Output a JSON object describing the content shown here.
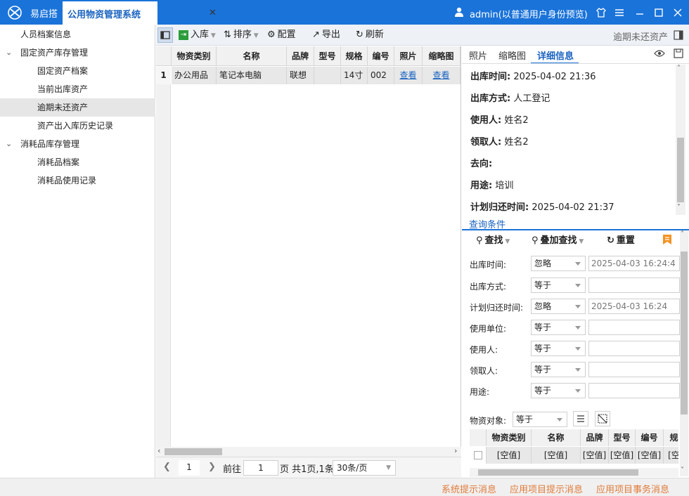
{
  "titlebar": {
    "app_name": "易启搭",
    "active_tab": "公用物资管理系统",
    "close_glyph": "✕",
    "user": "admin(以普通用户身份预览)",
    "icons": [
      "tshirt-icon",
      "menu-icon",
      "minimize-icon",
      "maximize-icon",
      "close-icon"
    ]
  },
  "sidebar": {
    "items": [
      {
        "label": "人员档案信息",
        "level": 0
      },
      {
        "label": "固定资产库存管理",
        "level": 0,
        "expanded": true
      },
      {
        "label": "固定资产档案",
        "level": 1
      },
      {
        "label": "当前出库资产",
        "level": 1
      },
      {
        "label": "逾期未还资产",
        "level": 1,
        "selected": true
      },
      {
        "label": "资产出入库历史记录",
        "level": 1
      },
      {
        "label": "消耗品库存管理",
        "level": 0,
        "expanded": true
      },
      {
        "label": "消耗品档案",
        "level": 1
      },
      {
        "label": "消耗品使用记录",
        "level": 1
      }
    ]
  },
  "toolbar": {
    "inbound": "入库",
    "sort": "排序",
    "config": "配置",
    "export": "导出",
    "refresh": "刷新",
    "current_view": "逾期未还资产"
  },
  "grid": {
    "headers": [
      "物资类别",
      "名称",
      "品牌",
      "型号",
      "规格",
      "编号",
      "照片",
      "缩略图"
    ],
    "rows": [
      {
        "num": "1",
        "cells": [
          "办公用品",
          "笔记本电脑",
          "联想",
          "",
          "14寸",
          "002",
          "查看",
          "查看"
        ]
      }
    ]
  },
  "pager": {
    "page_input": "1",
    "goto_label": "前往",
    "goto_value": "1",
    "summary": "页 共1页,1条",
    "page_size": "30条/页"
  },
  "detail_panel": {
    "tabs": [
      "照片",
      "缩略图",
      "详细信息"
    ],
    "active_tab": "详细信息",
    "fields": [
      {
        "label": "出库时间:",
        "value": "2025-04-02 21:36"
      },
      {
        "label": "出库方式:",
        "value": "人工登记"
      },
      {
        "label": "使用人:",
        "value": "姓名2"
      },
      {
        "label": "领取人:",
        "value": "姓名2"
      },
      {
        "label": "去向:",
        "value": ""
      },
      {
        "label": "用途:",
        "value": "培训"
      },
      {
        "label": "计划归还时间:",
        "value": "2025-04-02 21:37"
      }
    ]
  },
  "query": {
    "tab": "查询条件",
    "search": "查找",
    "add_search": "叠加查找",
    "reset": "重置",
    "conditions": [
      {
        "label": "出库时间:",
        "op": "忽略",
        "value": "2025-04-03 16:24:4"
      },
      {
        "label": "出库方式:",
        "op": "等于",
        "value": ""
      },
      {
        "label": "计划归还时间:",
        "op": "忽略",
        "value": "2025-04-03 16:24"
      },
      {
        "label": "使用单位:",
        "op": "等于",
        "value": ""
      },
      {
        "label": "使用人:",
        "op": "等于",
        "value": ""
      },
      {
        "label": "领取人:",
        "op": "等于",
        "value": ""
      },
      {
        "label": "用途:",
        "op": "等于",
        "value": ""
      }
    ],
    "object_label": "物资对象:",
    "object_op": "等于",
    "sub_headers": [
      "物资类别",
      "名称",
      "品牌",
      "型号",
      "编号",
      "规"
    ],
    "sub_row": [
      "[空值]",
      "[空值]",
      "[空值]",
      "[空值]",
      "[空值]",
      "[空"
    ]
  },
  "statusbar": {
    "items": [
      "系统提示消息",
      "应用项目提示消息",
      "应用项目事务消息"
    ]
  },
  "colors": {
    "accent": "#1a73d9",
    "status_text": "#e07b3a"
  }
}
